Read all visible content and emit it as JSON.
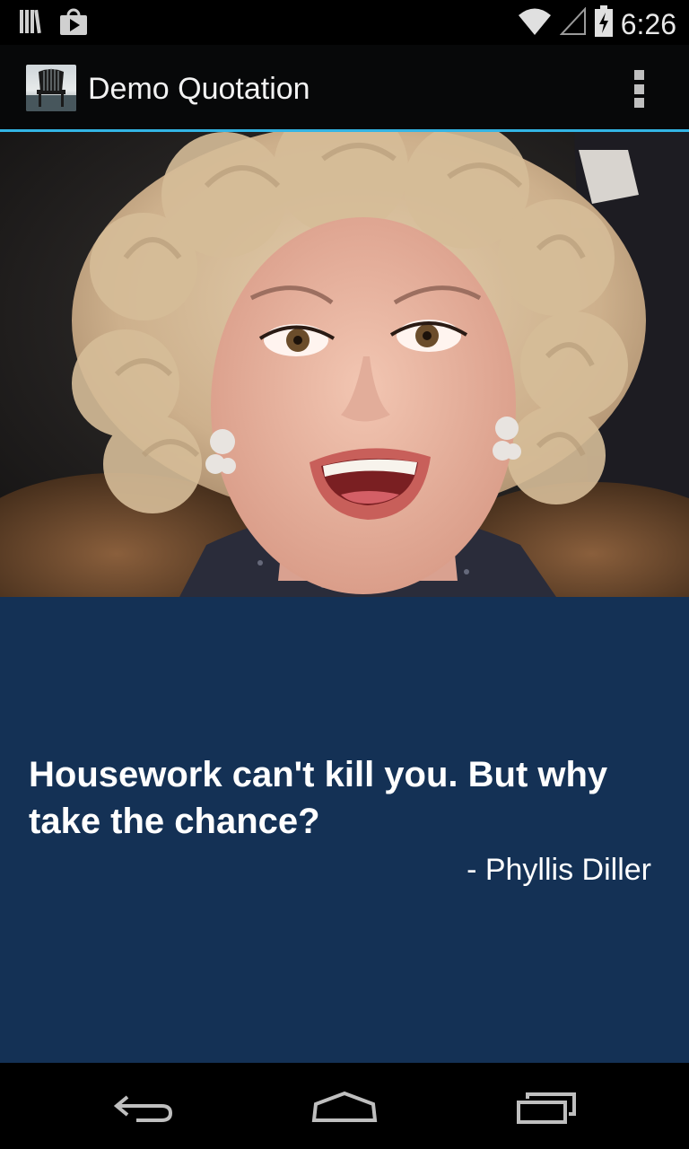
{
  "status_bar": {
    "time": "6:26",
    "icons": [
      "library-icon",
      "play-store-icon",
      "wifi-icon",
      "cell-signal-icon",
      "battery-charging-icon"
    ]
  },
  "action_bar": {
    "title": "Demo Quotation",
    "app_icon": "chair-icon",
    "menu_icon": "overflow-menu-icon"
  },
  "quote": {
    "text": "Housework can't kill you. But why take the chance?",
    "author": "- Phyllis Diller"
  },
  "nav_bar": {
    "icons": [
      "back-icon",
      "home-icon",
      "recents-icon"
    ]
  },
  "colors": {
    "accent": "#33b5e5",
    "quote_background": "#143155",
    "action_bar": "#070809"
  }
}
